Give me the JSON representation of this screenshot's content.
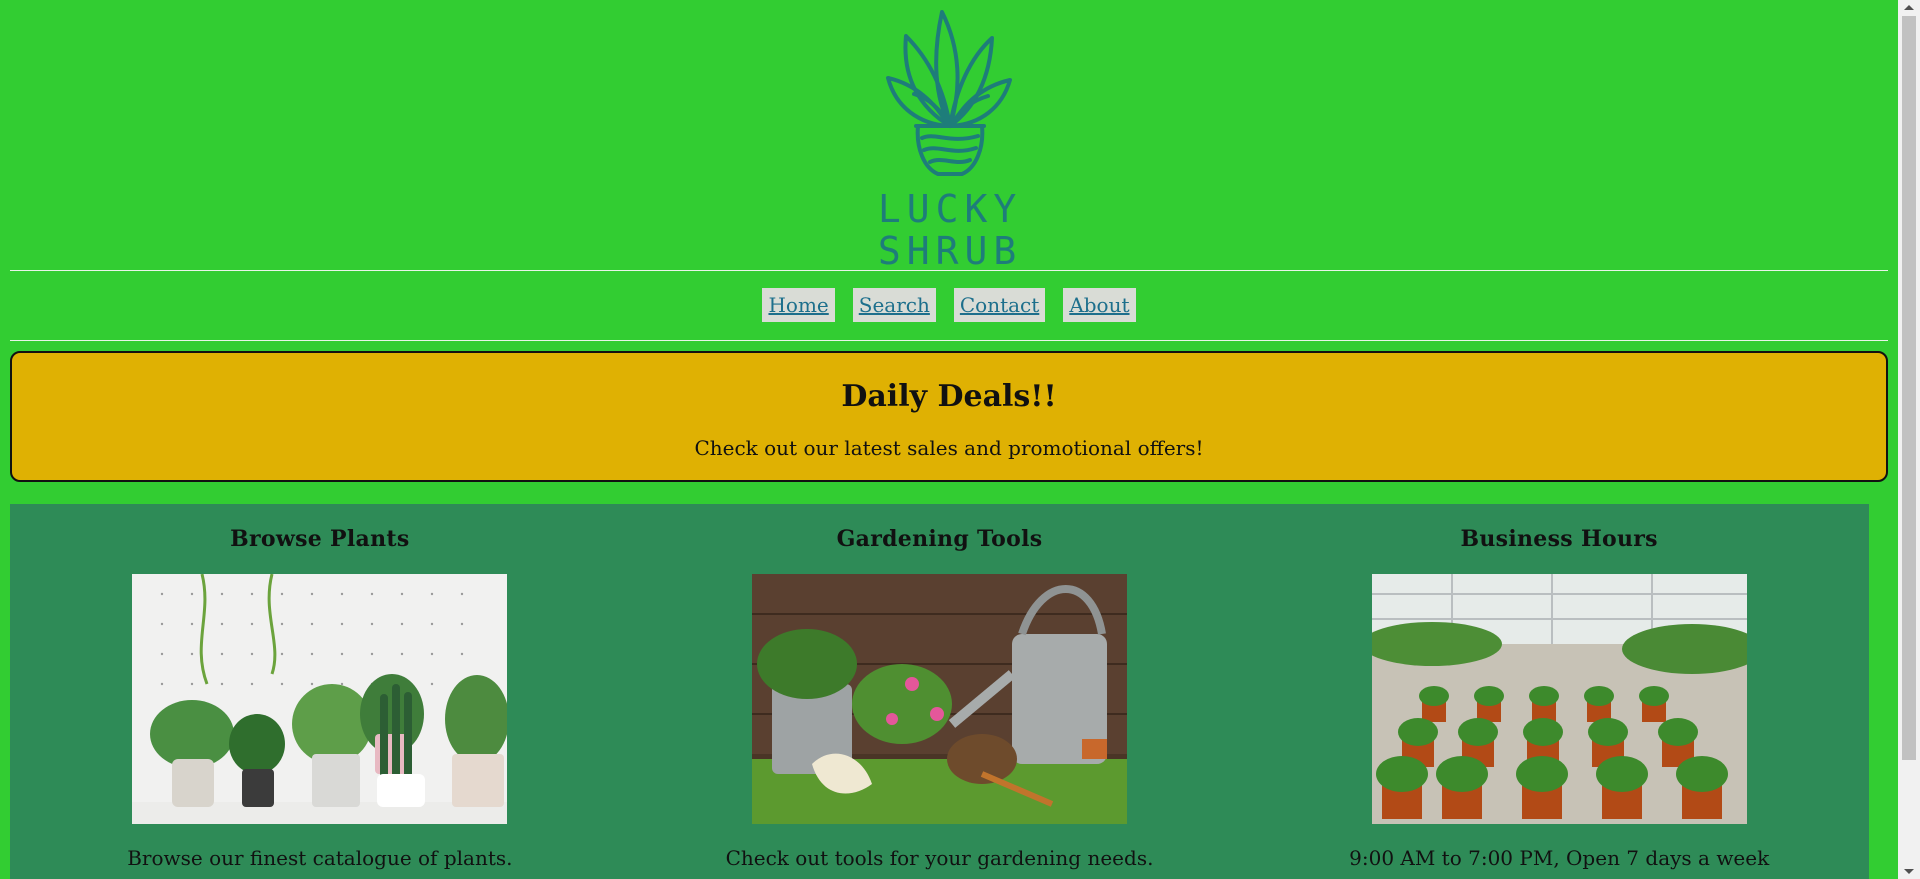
{
  "brand": {
    "name_line1": "LUCKY",
    "name_line2": "SHRUB",
    "logo_color": "#1e7d7a"
  },
  "nav": {
    "items": [
      {
        "label": "Home"
      },
      {
        "label": "Search"
      },
      {
        "label": "Contact"
      },
      {
        "label": "About"
      }
    ]
  },
  "deals": {
    "title": "Daily Deals!!",
    "text": "Check out our latest sales and promotional offers!"
  },
  "features": [
    {
      "title": "Browse Plants",
      "image_icon": "potted-plants-image",
      "text": "Browse our finest catalogue of plants."
    },
    {
      "title": "Gardening Tools",
      "image_icon": "gardening-tools-image",
      "text": "Check out tools for your gardening needs."
    },
    {
      "title": "Business Hours",
      "image_icon": "greenhouse-image",
      "text": "9:00 AM to 7:00 PM, Open 7 days a week"
    }
  ],
  "colors": {
    "page_bg": "#32cd32",
    "deals_bg": "#dfb103",
    "features_bg": "#2e8b57",
    "link": "#1d6f8c"
  }
}
